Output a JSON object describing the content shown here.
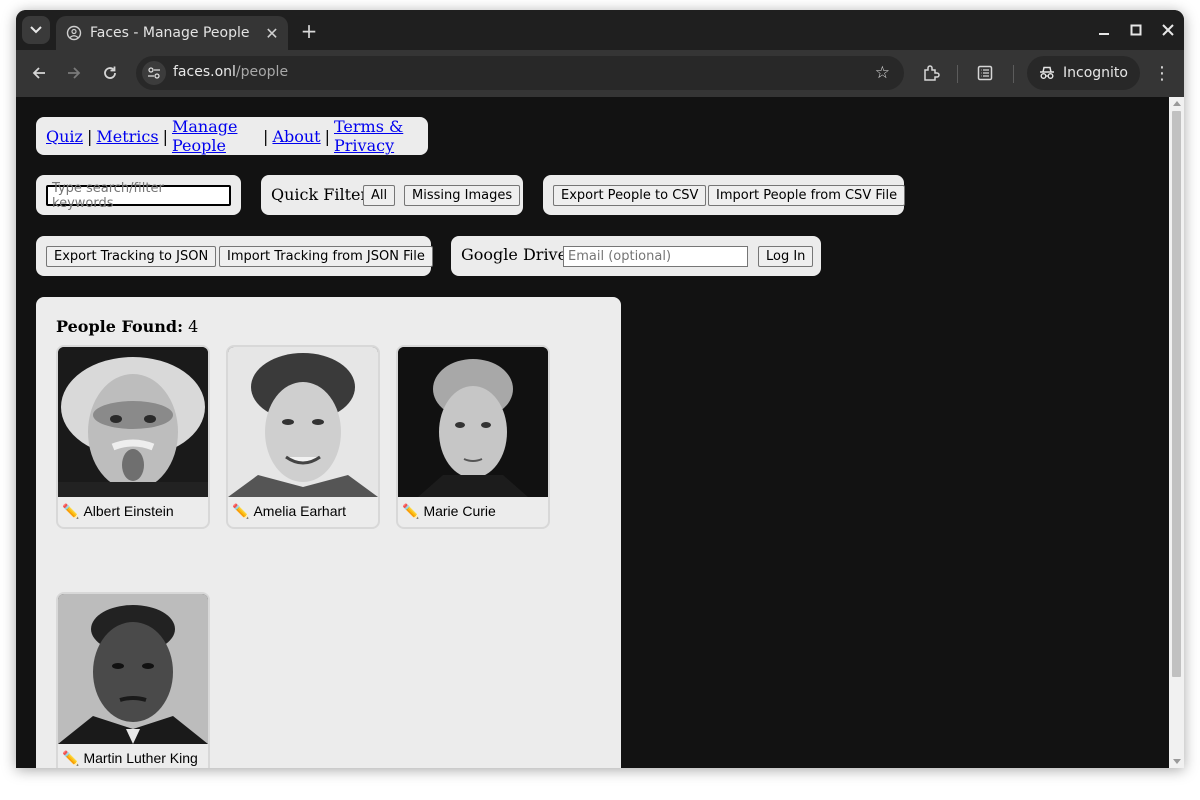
{
  "browser": {
    "tab_title": "Faces - Manage People",
    "url_domain": "faces.onl",
    "url_path": "/people",
    "incognito_label": "Incognito"
  },
  "nav": {
    "links": [
      "Quiz",
      "Metrics",
      "Manage People",
      "About",
      "Terms & Privacy"
    ],
    "separator": "|"
  },
  "search": {
    "placeholder": "Type search/filter keywords"
  },
  "quick_filter": {
    "label": "Quick Filter:",
    "all": "All",
    "missing": "Missing Images"
  },
  "people_csv": {
    "export": "Export People to CSV",
    "import": "Import People from CSV File"
  },
  "tracking": {
    "export": "Export Tracking to JSON",
    "import": "Import Tracking from JSON File"
  },
  "google_drive": {
    "label": "Google Drive:",
    "email_placeholder": "Email (optional)",
    "login": "Log In"
  },
  "results": {
    "label": "People Found:",
    "count": "4",
    "people": [
      {
        "name": "Albert Einstein",
        "edit_icon": "pencil-icon"
      },
      {
        "name": "Amelia Earhart",
        "edit_icon": "pencil-icon"
      },
      {
        "name": "Marie Curie",
        "edit_icon": "pencil-icon"
      },
      {
        "name": "Martin Luther King",
        "edit_icon": "pencil-icon"
      }
    ]
  },
  "colors": {
    "page_bg": "#121212",
    "panel_bg": "#ececec",
    "link": "#0000ee",
    "chrome_dark": "#1f1f1f",
    "chrome_toolbar": "#353535"
  }
}
